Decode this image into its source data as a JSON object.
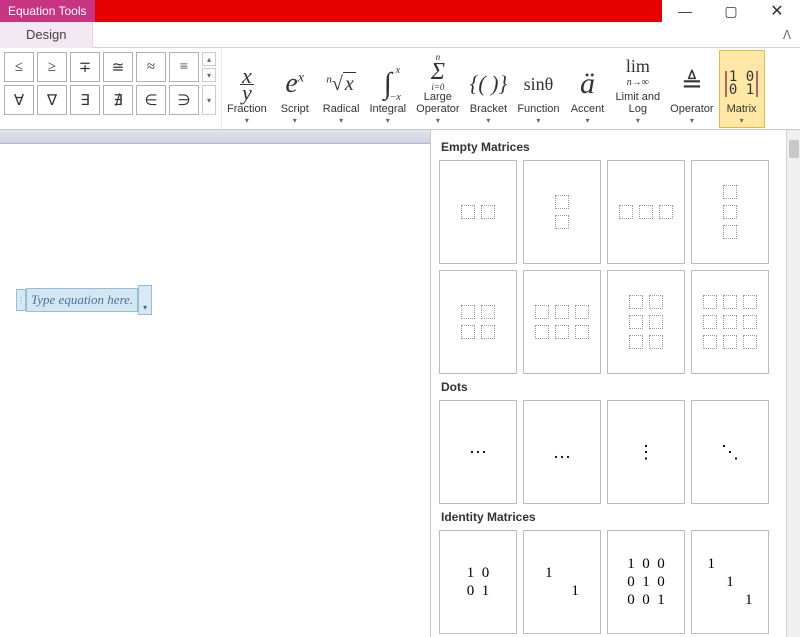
{
  "title_tab": "Equation Tools",
  "tabs": {
    "design": "Design"
  },
  "window": {
    "minimize": "—",
    "maximize": "▢",
    "close": "✕",
    "collapse_ribbon": "ᐱ"
  },
  "symbols_row1": [
    "≤",
    "≥",
    "∓",
    "≅",
    "≈",
    "≡"
  ],
  "symbols_row2": [
    "∀",
    "∇",
    "∃",
    "∄",
    "∈",
    "∋"
  ],
  "structures": [
    {
      "name": "fraction",
      "label": "Fraction",
      "icon_text": "x\n—\ny"
    },
    {
      "name": "script",
      "label": "Script",
      "icon_text": "eˣ"
    },
    {
      "name": "radical",
      "label": "Radical",
      "icon_text": "ⁿ√x"
    },
    {
      "name": "integral",
      "label": "Integral",
      "icon_text": "∫"
    },
    {
      "name": "large-op",
      "label": "Large\nOperator",
      "icon_text": "Σ"
    },
    {
      "name": "bracket",
      "label": "Bracket",
      "icon_text": "{()}"
    },
    {
      "name": "function",
      "label": "Function",
      "icon_text": "sinθ"
    },
    {
      "name": "accent",
      "label": "Accent",
      "icon_text": "ä"
    },
    {
      "name": "limit-log",
      "label": "Limit and\nLog",
      "icon_text": "lim"
    },
    {
      "name": "operator",
      "label": "Operator",
      "icon_text": "≜"
    },
    {
      "name": "matrix",
      "label": "Matrix",
      "icon_text": "[10\n01]",
      "selected": true
    }
  ],
  "equation_placeholder": "Type equation here.",
  "matrix_dropdown": {
    "groups": [
      {
        "title": "Empty Matrices",
        "rows": [
          [
            {
              "r": 1,
              "c": 2
            },
            {
              "r": 2,
              "c": 1
            },
            {
              "r": 1,
              "c": 3
            },
            {
              "r": 3,
              "c": 1
            }
          ],
          [
            {
              "r": 2,
              "c": 2
            },
            {
              "r": 2,
              "c": 3
            },
            {
              "r": 3,
              "c": 2
            },
            {
              "r": 3,
              "c": 3
            }
          ]
        ]
      },
      {
        "title": "Dots",
        "rows": [
          [
            {
              "dots": "⋯"
            },
            {
              "dots": "…"
            },
            {
              "dots": "⋮"
            },
            {
              "dots": "⋱"
            }
          ]
        ]
      },
      {
        "title": "Identity Matrices",
        "rows": [
          [
            {
              "id": "1  0\n0  1"
            },
            {
              "id": "1       \n       1"
            },
            {
              "id": "1  0  0\n0  1  0\n0  0  1"
            },
            {
              "id": "1          \n     1     \n          1"
            }
          ]
        ]
      }
    ]
  }
}
